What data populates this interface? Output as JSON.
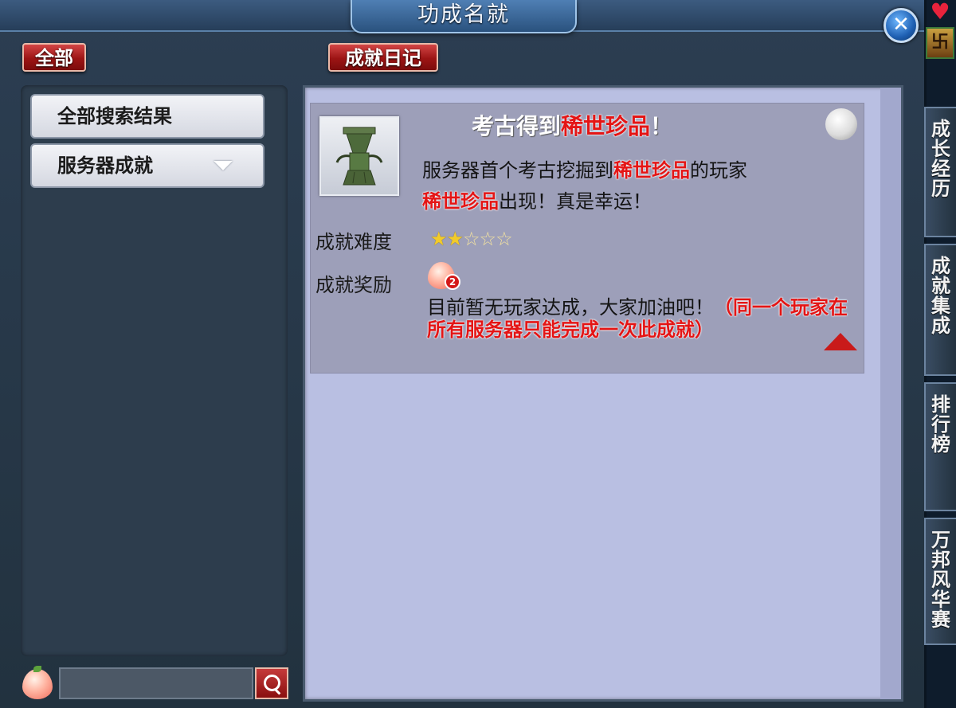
{
  "window": {
    "title": "功成名就",
    "close_icon": "close-icon"
  },
  "toolbar": {
    "all_label": "全部",
    "diary_label": "成就日记"
  },
  "categories": [
    {
      "label": "全部搜索结果"
    },
    {
      "label": "服务器成就"
    }
  ],
  "achievement": {
    "title_prefix": "考古得到",
    "title_highlight": "稀世珍品",
    "title_suffix": "！",
    "desc_line1_prefix": "服务器首个考古挖掘到",
    "desc_line1_highlight": "稀世珍品",
    "desc_line1_suffix": "的玩家",
    "desc_line2_highlight": "稀世珍品",
    "desc_line2_suffix": "出现！真是幸运！",
    "difficulty_label": "成就难度",
    "difficulty_stars": 2,
    "difficulty_max": 5,
    "reward_label": "成就奖励",
    "reward_count": "2",
    "status_text": "目前暂无玩家达成，大家加油吧！",
    "status_note": "（同一个玩家在所有服务器只能完成一次此成就）"
  },
  "side_tabs": [
    {
      "label": "成长经历"
    },
    {
      "label": "成就集成"
    },
    {
      "label": "排行榜"
    },
    {
      "label": "万邦风华赛"
    }
  ],
  "colors": {
    "highlight_red": "#e41515",
    "button_red": "#9c1414",
    "panel_lavender": "#b9bfe2"
  }
}
